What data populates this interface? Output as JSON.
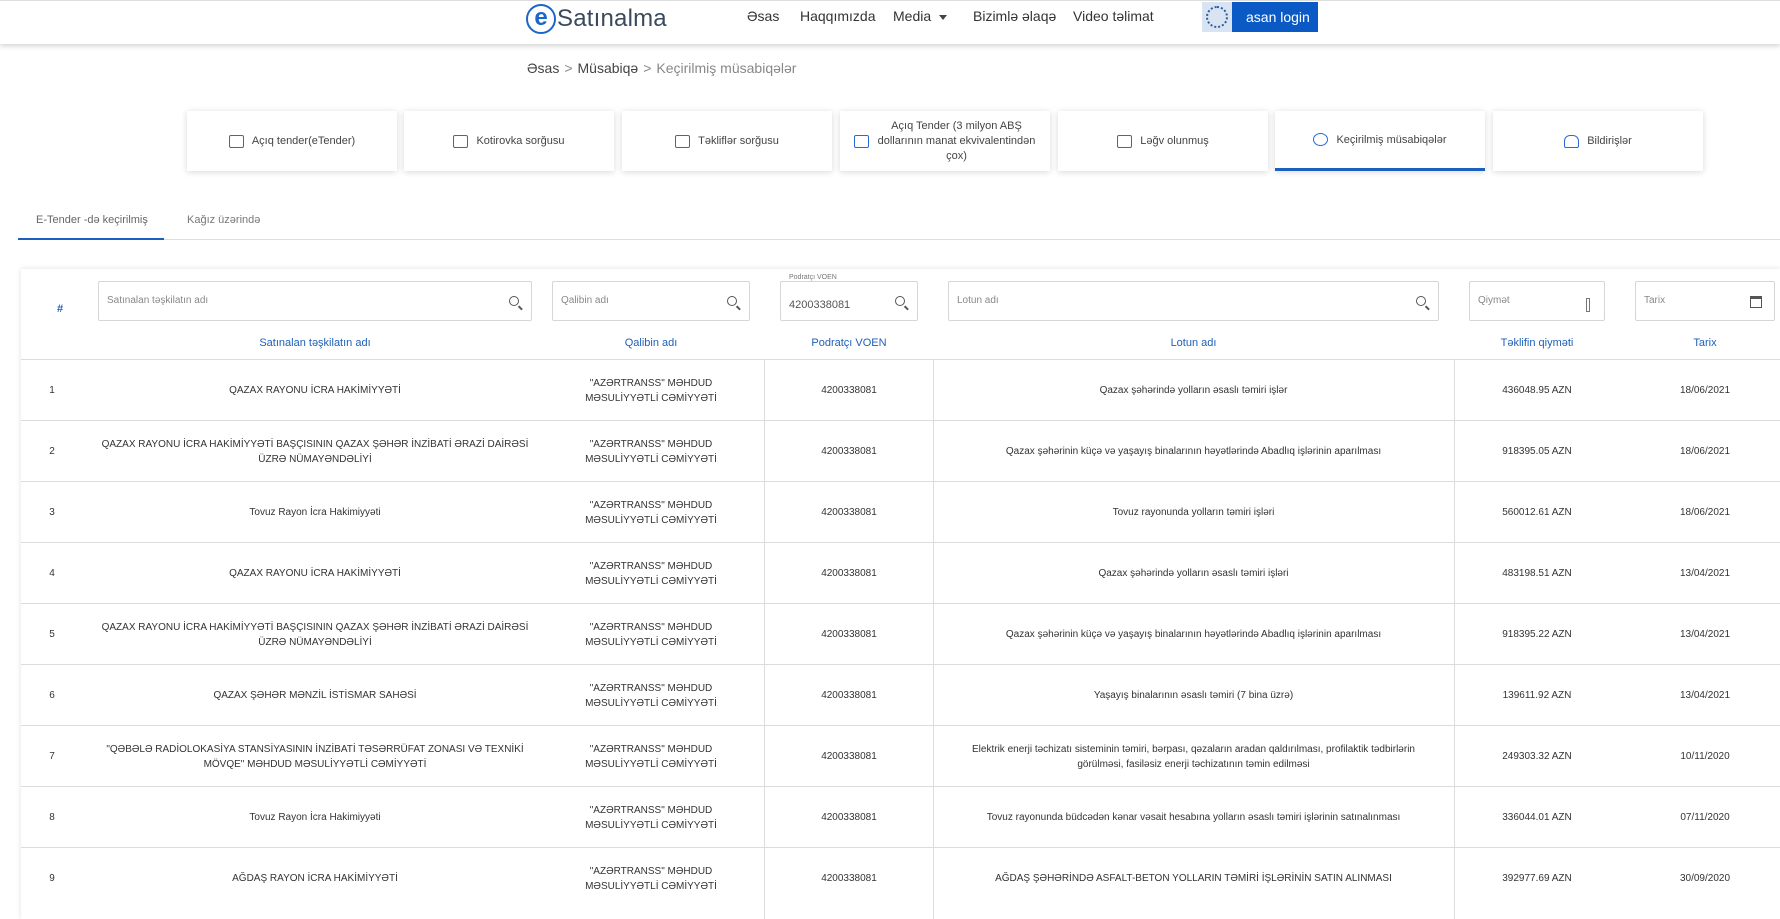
{
  "header": {
    "logo_letter": "e",
    "logo_text": "Satınalma",
    "nav": [
      "Əsas",
      "Haqqımızda",
      "Media",
      "Bizimlə əlaqə",
      "Video təlimat"
    ],
    "asan_login": "asan login"
  },
  "breadcrumb": [
    "Əsas",
    "Müsabiqə",
    "Keçirilmiş müsabiqələr"
  ],
  "breadcrumb_sep": ">",
  "cards": [
    "Açıq tender(eTender)",
    "Kotirovka sorğusu",
    "Təkliflər sorğusu",
    "Açıq Tender (3 milyon ABŞ dollarının manat ekvivalentindən çox)",
    "Ləğv olunmuş",
    "Keçirilmiş müsabiqələr",
    "Bildirişlər"
  ],
  "active_card": 5,
  "subtabs": [
    "E-Tender -də keçirilmiş",
    "Kağız üzərində"
  ],
  "filters": {
    "org_placeholder": "Satınalan təşkilatın adı",
    "winner_placeholder": "Qalibin adı",
    "voen_label": "Podratçı VOEN",
    "voen_value": "4200338081",
    "lot_placeholder": "Lotun adı",
    "price_placeholder": "Qiymət",
    "date_placeholder": "Tarix"
  },
  "table": {
    "hash": "#",
    "columns": [
      "Satınalan təşkilatın adı",
      "Qalibin adı",
      "Podratçı VOEN",
      "Lotun adı",
      "Təklifin qiyməti",
      "Tarix"
    ],
    "rows": [
      {
        "n": "1",
        "org": "QAZAX RAYONU İCRA HAKİMİYYƏTİ",
        "winner": "\"AZƏRTRANSS\" MƏHDUD MƏSULİYYƏTLİ CƏMİYYƏTİ",
        "voen": "4200338081",
        "lot": "Qazax şəhərində yolların əsaslı təmiri işlər",
        "price": "436048.95 AZN",
        "date": "18/06/2021"
      },
      {
        "n": "2",
        "org": "QAZAX RAYONU İCRA HAKİMİYYƏTİ BAŞÇISININ QAZAX ŞƏHƏR İNZİBATİ ƏRAZİ DAİRƏSİ ÜZRƏ NÜMAYƏNDƏLİYİ",
        "winner": "\"AZƏRTRANSS\" MƏHDUD MƏSULİYYƏTLİ CƏMİYYƏTİ",
        "voen": "4200338081",
        "lot": "Qazax şəhərinin küçə və yaşayış binalarının həyətlərində Abadlıq işlərinin aparılması",
        "price": "918395.05 AZN",
        "date": "18/06/2021"
      },
      {
        "n": "3",
        "org": "Tovuz Rayon İcra Hakimiyyəti",
        "winner": "\"AZƏRTRANSS\" MƏHDUD MƏSULİYYƏTLİ CƏMİYYƏTİ",
        "voen": "4200338081",
        "lot": "Tovuz rayonunda yolların təmiri işləri",
        "price": "560012.61 AZN",
        "date": "18/06/2021"
      },
      {
        "n": "4",
        "org": "QAZAX RAYONU İCRA HAKİMİYYƏTİ",
        "winner": "\"AZƏRTRANSS\" MƏHDUD MƏSULİYYƏTLİ CƏMİYYƏTİ",
        "voen": "4200338081",
        "lot": "Qazax şəhərində yolların əsaslı təmiri işləri",
        "price": "483198.51 AZN",
        "date": "13/04/2021"
      },
      {
        "n": "5",
        "org": "QAZAX RAYONU İCRA HAKİMİYYƏTİ BAŞÇISININ QAZAX ŞƏHƏR İNZİBATİ ƏRAZİ DAİRƏSİ ÜZRƏ NÜMAYƏNDƏLİYİ",
        "winner": "\"AZƏRTRANSS\" MƏHDUD MƏSULİYYƏTLİ CƏMİYYƏTİ",
        "voen": "4200338081",
        "lot": "Qazax şəhərinin küçə və yaşayış binalarının həyətlərində Abadlıq işlərinin aparılması",
        "price": "918395.22 AZN",
        "date": "13/04/2021"
      },
      {
        "n": "6",
        "org": "QAZAX ŞƏHƏR MƏNZİL İSTİSMAR SAHƏSİ",
        "winner": "\"AZƏRTRANSS\" MƏHDUD MƏSULİYYƏTLİ CƏMİYYƏTİ",
        "voen": "4200338081",
        "lot": "Yaşayış binalarının əsaslı təmiri (7 bina üzrə)",
        "price": "139611.92 AZN",
        "date": "13/04/2021"
      },
      {
        "n": "7",
        "org": "\"QƏBƏLƏ RADİOLOKASİYA STANSİYASININ İNZİBATİ TƏSƏRRÜFAT ZONASI VƏ TEXNİKİ MÖVQE\" MƏHDUD MƏSULİYYƏTLİ CƏMİYYƏTİ",
        "winner": "\"AZƏRTRANSS\" MƏHDUD MƏSULİYYƏTLİ CƏMİYYƏTİ",
        "voen": "4200338081",
        "lot": "Elektrik enerji təchizatı sisteminin təmiri, bərpası, qəzaların aradan qaldırılması, profilaktik tədbirlərin görülməsi, fasiləsiz enerji təchizatının təmin edilməsi",
        "price": "249303.32 AZN",
        "date": "10/11/2020"
      },
      {
        "n": "8",
        "org": "Tovuz Rayon İcra Hakimiyyəti",
        "winner": "\"AZƏRTRANSS\" MƏHDUD MƏSULİYYƏTLİ CƏMİYYƏTİ",
        "voen": "4200338081",
        "lot": "Tovuz rayonunda büdcədən kənar vəsait hesabına yolların əsaslı təmiri işlərinin satınalınması",
        "price": "336044.01 AZN",
        "date": "07/11/2020"
      },
      {
        "n": "9",
        "org": "AĞDAŞ RAYON İCRA HAKİMİYYƏTİ",
        "winner": "\"AZƏRTRANSS\" MƏHDUD MƏSULİYYƏTLİ CƏMİYYƏTİ",
        "voen": "4200338081",
        "lot": "AĞDAŞ ŞƏHƏRİNDƏ ASFALT-BETON YOLLARIN TƏMİRİ İŞLƏRİNİN SATIN ALINMASI",
        "price": "392977.69 AZN",
        "date": "30/09/2020"
      }
    ]
  },
  "colors": {
    "primary": "#1b5fbf",
    "header_link": "#1e5fb8",
    "asan": "#0a59c4"
  }
}
